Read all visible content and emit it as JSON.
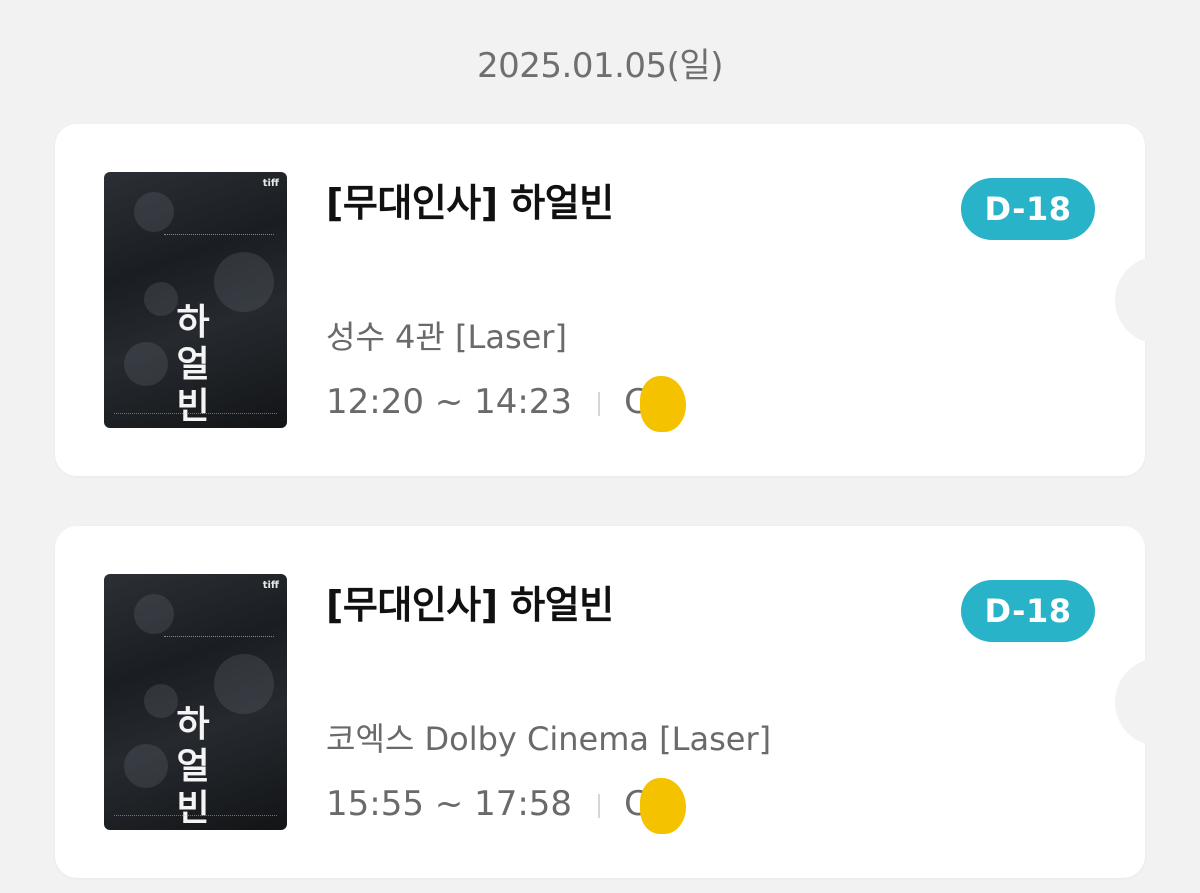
{
  "date_header": "2025.01.05(일)",
  "tickets": [
    {
      "poster": {
        "badge": "tiff",
        "title_chars": "하\n얼\n빈"
      },
      "title": "[무대인사] 하얼빈",
      "dday": "D-18",
      "venue": "성수 4관 [Laser]",
      "time": "12:20 ~ 14:23",
      "seat": "C"
    },
    {
      "poster": {
        "badge": "tiff",
        "title_chars": "하\n얼\n빈"
      },
      "title": "[무대인사] 하얼빈",
      "dday": "D-18",
      "venue": "코엑스 Dolby Cinema [Laser]",
      "time": "15:55 ~ 17:58",
      "seat": "C"
    }
  ],
  "colors": {
    "background": "#f2f2f2",
    "card": "#ffffff",
    "dday_badge": "#29b3c8",
    "redaction": "#f5c200"
  }
}
